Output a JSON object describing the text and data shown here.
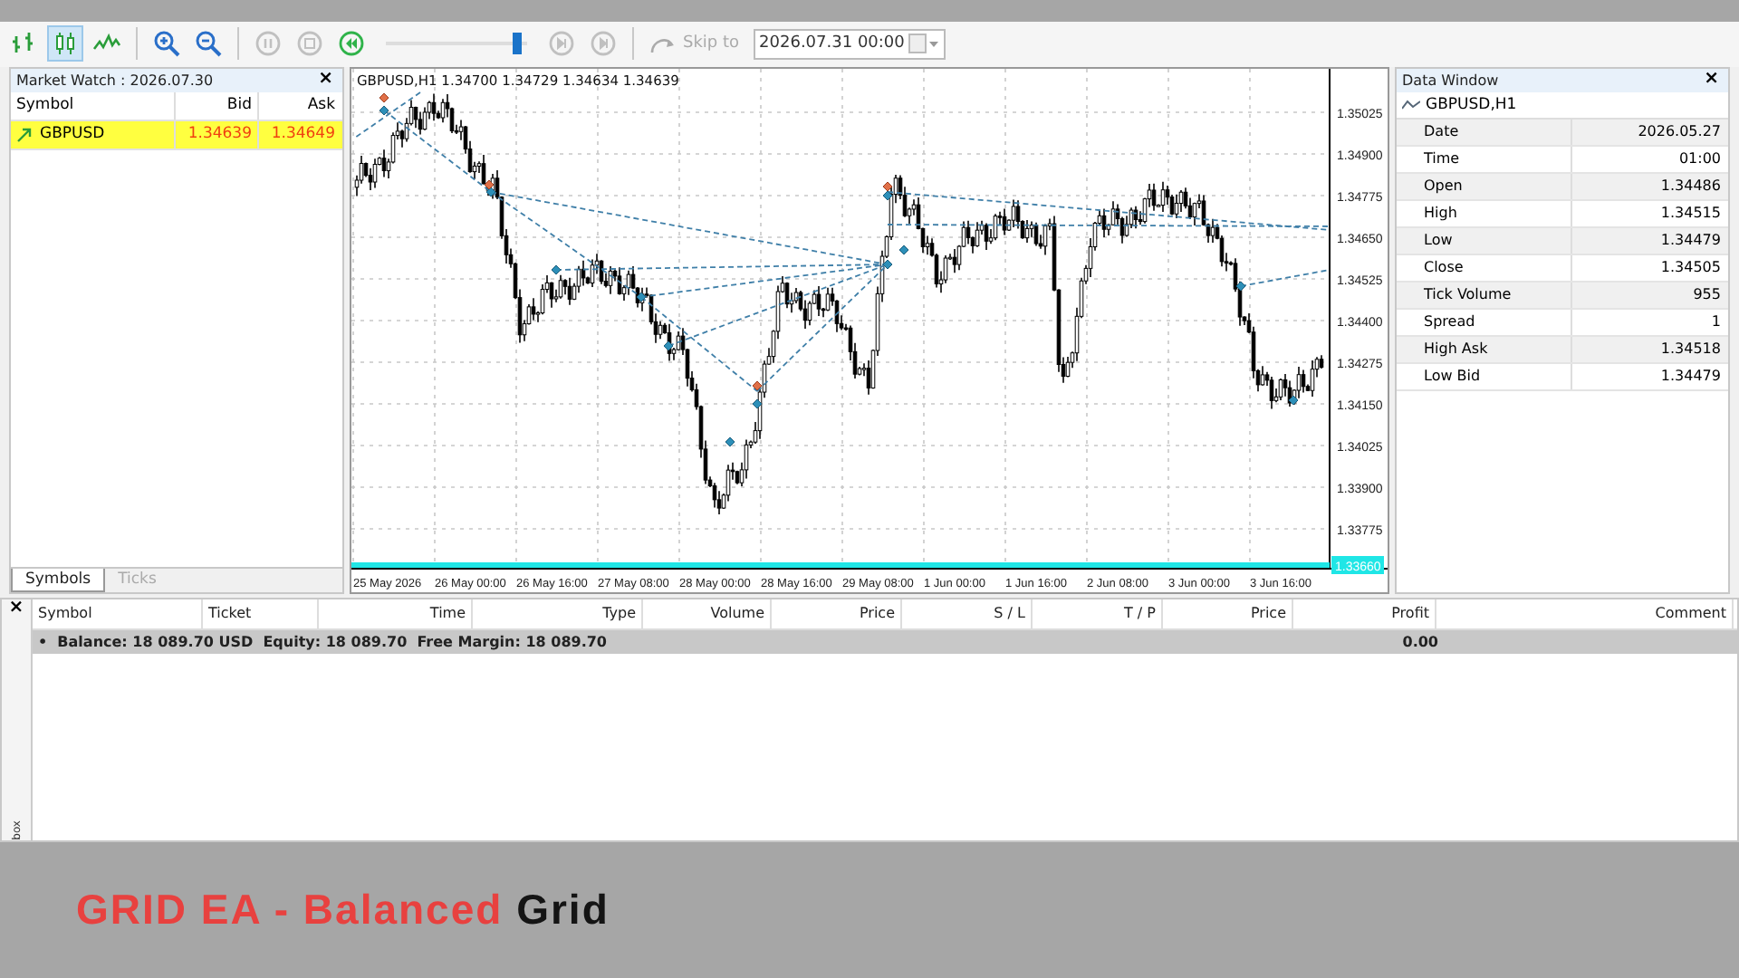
{
  "toolbar": {
    "chart_type_buttons": [
      {
        "kind": "bars",
        "selected": false
      },
      {
        "kind": "candles",
        "selected": true
      },
      {
        "kind": "line",
        "selected": false
      }
    ],
    "zoom_buttons": [
      {
        "kind": "zoom_in"
      },
      {
        "kind": "zoom_out"
      }
    ],
    "playback_buttons": [
      {
        "kind": "pause",
        "disabled": true
      },
      {
        "kind": "stop",
        "disabled": true
      },
      {
        "kind": "rewind",
        "disabled": false
      }
    ],
    "speed_slider": {
      "level": 0.97
    },
    "step_buttons": [
      {
        "kind": "step",
        "disabled": true
      },
      {
        "kind": "end",
        "disabled": true
      }
    ],
    "skip_to": {
      "label": "Skip to",
      "disabled": true
    },
    "date_field": {
      "value": "2026.07.31 00:00"
    }
  },
  "market_watch": {
    "title": "Market Watch : 2026.07.30",
    "close": "×",
    "columns": [
      "Symbol",
      "Bid",
      "Ask"
    ],
    "rows": [
      {
        "symbol": "GBPUSD",
        "bid": "1.34639",
        "ask": "1.34649",
        "selected": true
      }
    ],
    "tabs": [
      {
        "label": "Symbols",
        "selected": true
      },
      {
        "label": "Ticks",
        "selected": false
      }
    ]
  },
  "chart": {
    "symbol": "GBPUSD,H1",
    "ohlc": "1.34700 1.34729 1.34634 1.34639",
    "price_labels": [
      "1.35025",
      "1.34900",
      "1.34775",
      "1.34650",
      "1.34525",
      "1.34400",
      "1.34275",
      "1.34150",
      "1.34025",
      "1.33900",
      "1.33775"
    ],
    "time_labels": [
      "25 May 2026",
      "26 May 00:00",
      "26 May 16:00",
      "27 May 08:00",
      "28 May 00:00",
      "28 May 16:00",
      "29 May 08:00",
      "1 Jun 00:00",
      "1 Jun 16:00",
      "2 Jun 08:00",
      "3 Jun 00:00",
      "3 Jun 16:00"
    ],
    "current_price": "1.33660"
  },
  "data_window": {
    "title": "Data Window",
    "close": "×",
    "symbol": "GBPUSD,H1",
    "rows": [
      {
        "label": "Date",
        "value": "2026.05.27"
      },
      {
        "label": "Time",
        "value": "01:00"
      },
      {
        "label": "Open",
        "value": "1.34486"
      },
      {
        "label": "High",
        "value": "1.34515"
      },
      {
        "label": "Low",
        "value": "1.34479"
      },
      {
        "label": "Close",
        "value": "1.34505"
      },
      {
        "label": "Tick Volume",
        "value": "955"
      },
      {
        "label": "Spread",
        "value": "1"
      },
      {
        "label": "High Ask",
        "value": "1.34518"
      },
      {
        "label": "Low Bid",
        "value": "1.34479"
      }
    ]
  },
  "toolbox": {
    "close": "×",
    "side_label": "box",
    "columns": [
      "Symbol",
      "Ticket",
      "Time",
      "Type",
      "Volume",
      "Price",
      "S / L",
      "T / P",
      "Price",
      "Profit",
      "Comment"
    ],
    "balance_row": {
      "bullet": "•",
      "summary": "Balance: 18 089.70 USD  Equity: 18 089.70  Free Margin: 18 089.70",
      "profit": "0.00"
    }
  },
  "caption": {
    "parts": [
      {
        "text": "GRID EA - Balanced",
        "color": "#e8413f"
      },
      {
        "text": "Grid",
        "color": "#141414"
      }
    ]
  }
}
